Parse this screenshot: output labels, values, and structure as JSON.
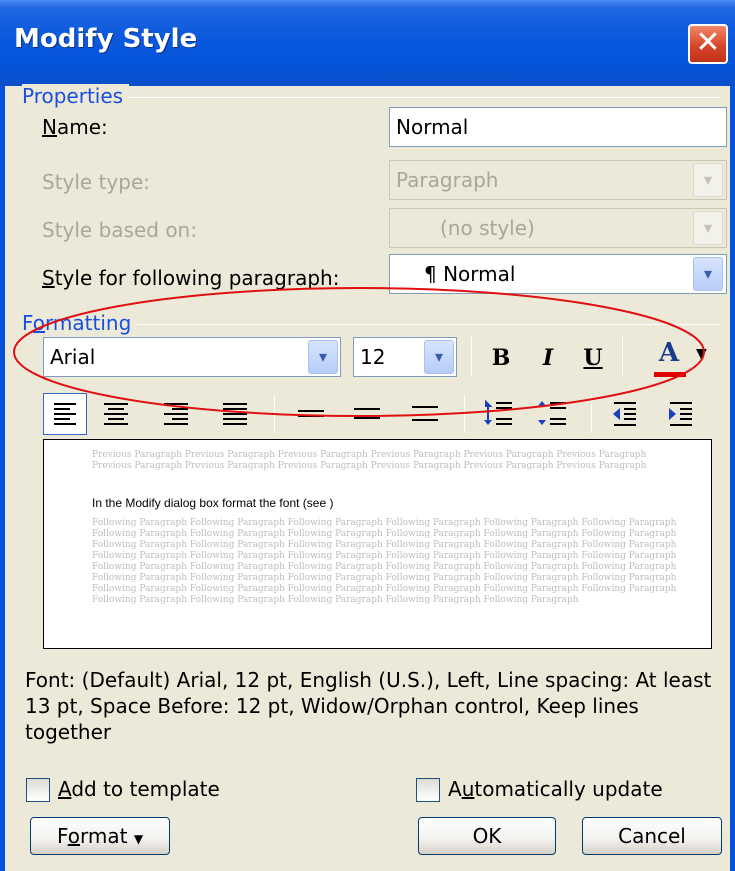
{
  "window": {
    "title": "Modify Style",
    "close_symbol": "✕"
  },
  "properties": {
    "group_label": "Properties",
    "name_label": "Name:",
    "name_value": "Normal",
    "style_type_label": "Style type:",
    "style_type_value": "Paragraph",
    "based_on_label": "Style based on:",
    "based_on_value": "(no style)",
    "following_label": "Style for following paragraph:",
    "following_value": "¶ Normal"
  },
  "formatting": {
    "group_label": "Formatting",
    "font_value": "Arial",
    "size_value": "12",
    "bold": "B",
    "italic": "I",
    "underline": "U",
    "font_color_letter": "A",
    "font_color": "#e00000"
  },
  "preview": {
    "prev_lines": [
      "Previous Paragraph Previous Paragraph Previous Paragraph Previous Paragraph Previous Paragraph Previous Paragraph",
      "Previous Paragraph Previous Paragraph Previous Paragraph Previous Paragraph Previous Paragraph Previous Paragraph"
    ],
    "main_text": "In the Modify dialog box format the font (see )",
    "follow_lines": [
      "Following Paragraph Following Paragraph Following Paragraph Following Paragraph Following Paragraph Following Paragraph",
      "Following Paragraph Following Paragraph Following Paragraph Following Paragraph Following Paragraph Following Paragraph",
      "Following Paragraph Following Paragraph Following Paragraph Following Paragraph Following Paragraph Following Paragraph",
      "Following Paragraph Following Paragraph Following Paragraph Following Paragraph Following Paragraph Following Paragraph",
      "Following Paragraph Following Paragraph Following Paragraph Following Paragraph Following Paragraph Following Paragraph",
      "Following Paragraph Following Paragraph Following Paragraph Following Paragraph Following Paragraph Following Paragraph",
      "Following Paragraph Following Paragraph Following Paragraph Following Paragraph Following Paragraph Following Paragraph",
      "Following Paragraph Following Paragraph Following Paragraph Following Paragraph Following Paragraph"
    ]
  },
  "description": "Font: (Default) Arial, 12 pt, English (U.S.), Left, Line spacing:  At least 13 pt, Space Before:  12 pt, Widow/Orphan control, Keep lines together",
  "options": {
    "add_to_template": "Add to template",
    "auto_update": "Automatically update"
  },
  "buttons": {
    "format": "Format",
    "ok": "OK",
    "cancel": "Cancel"
  },
  "annotation": {
    "color": "#e01010"
  }
}
